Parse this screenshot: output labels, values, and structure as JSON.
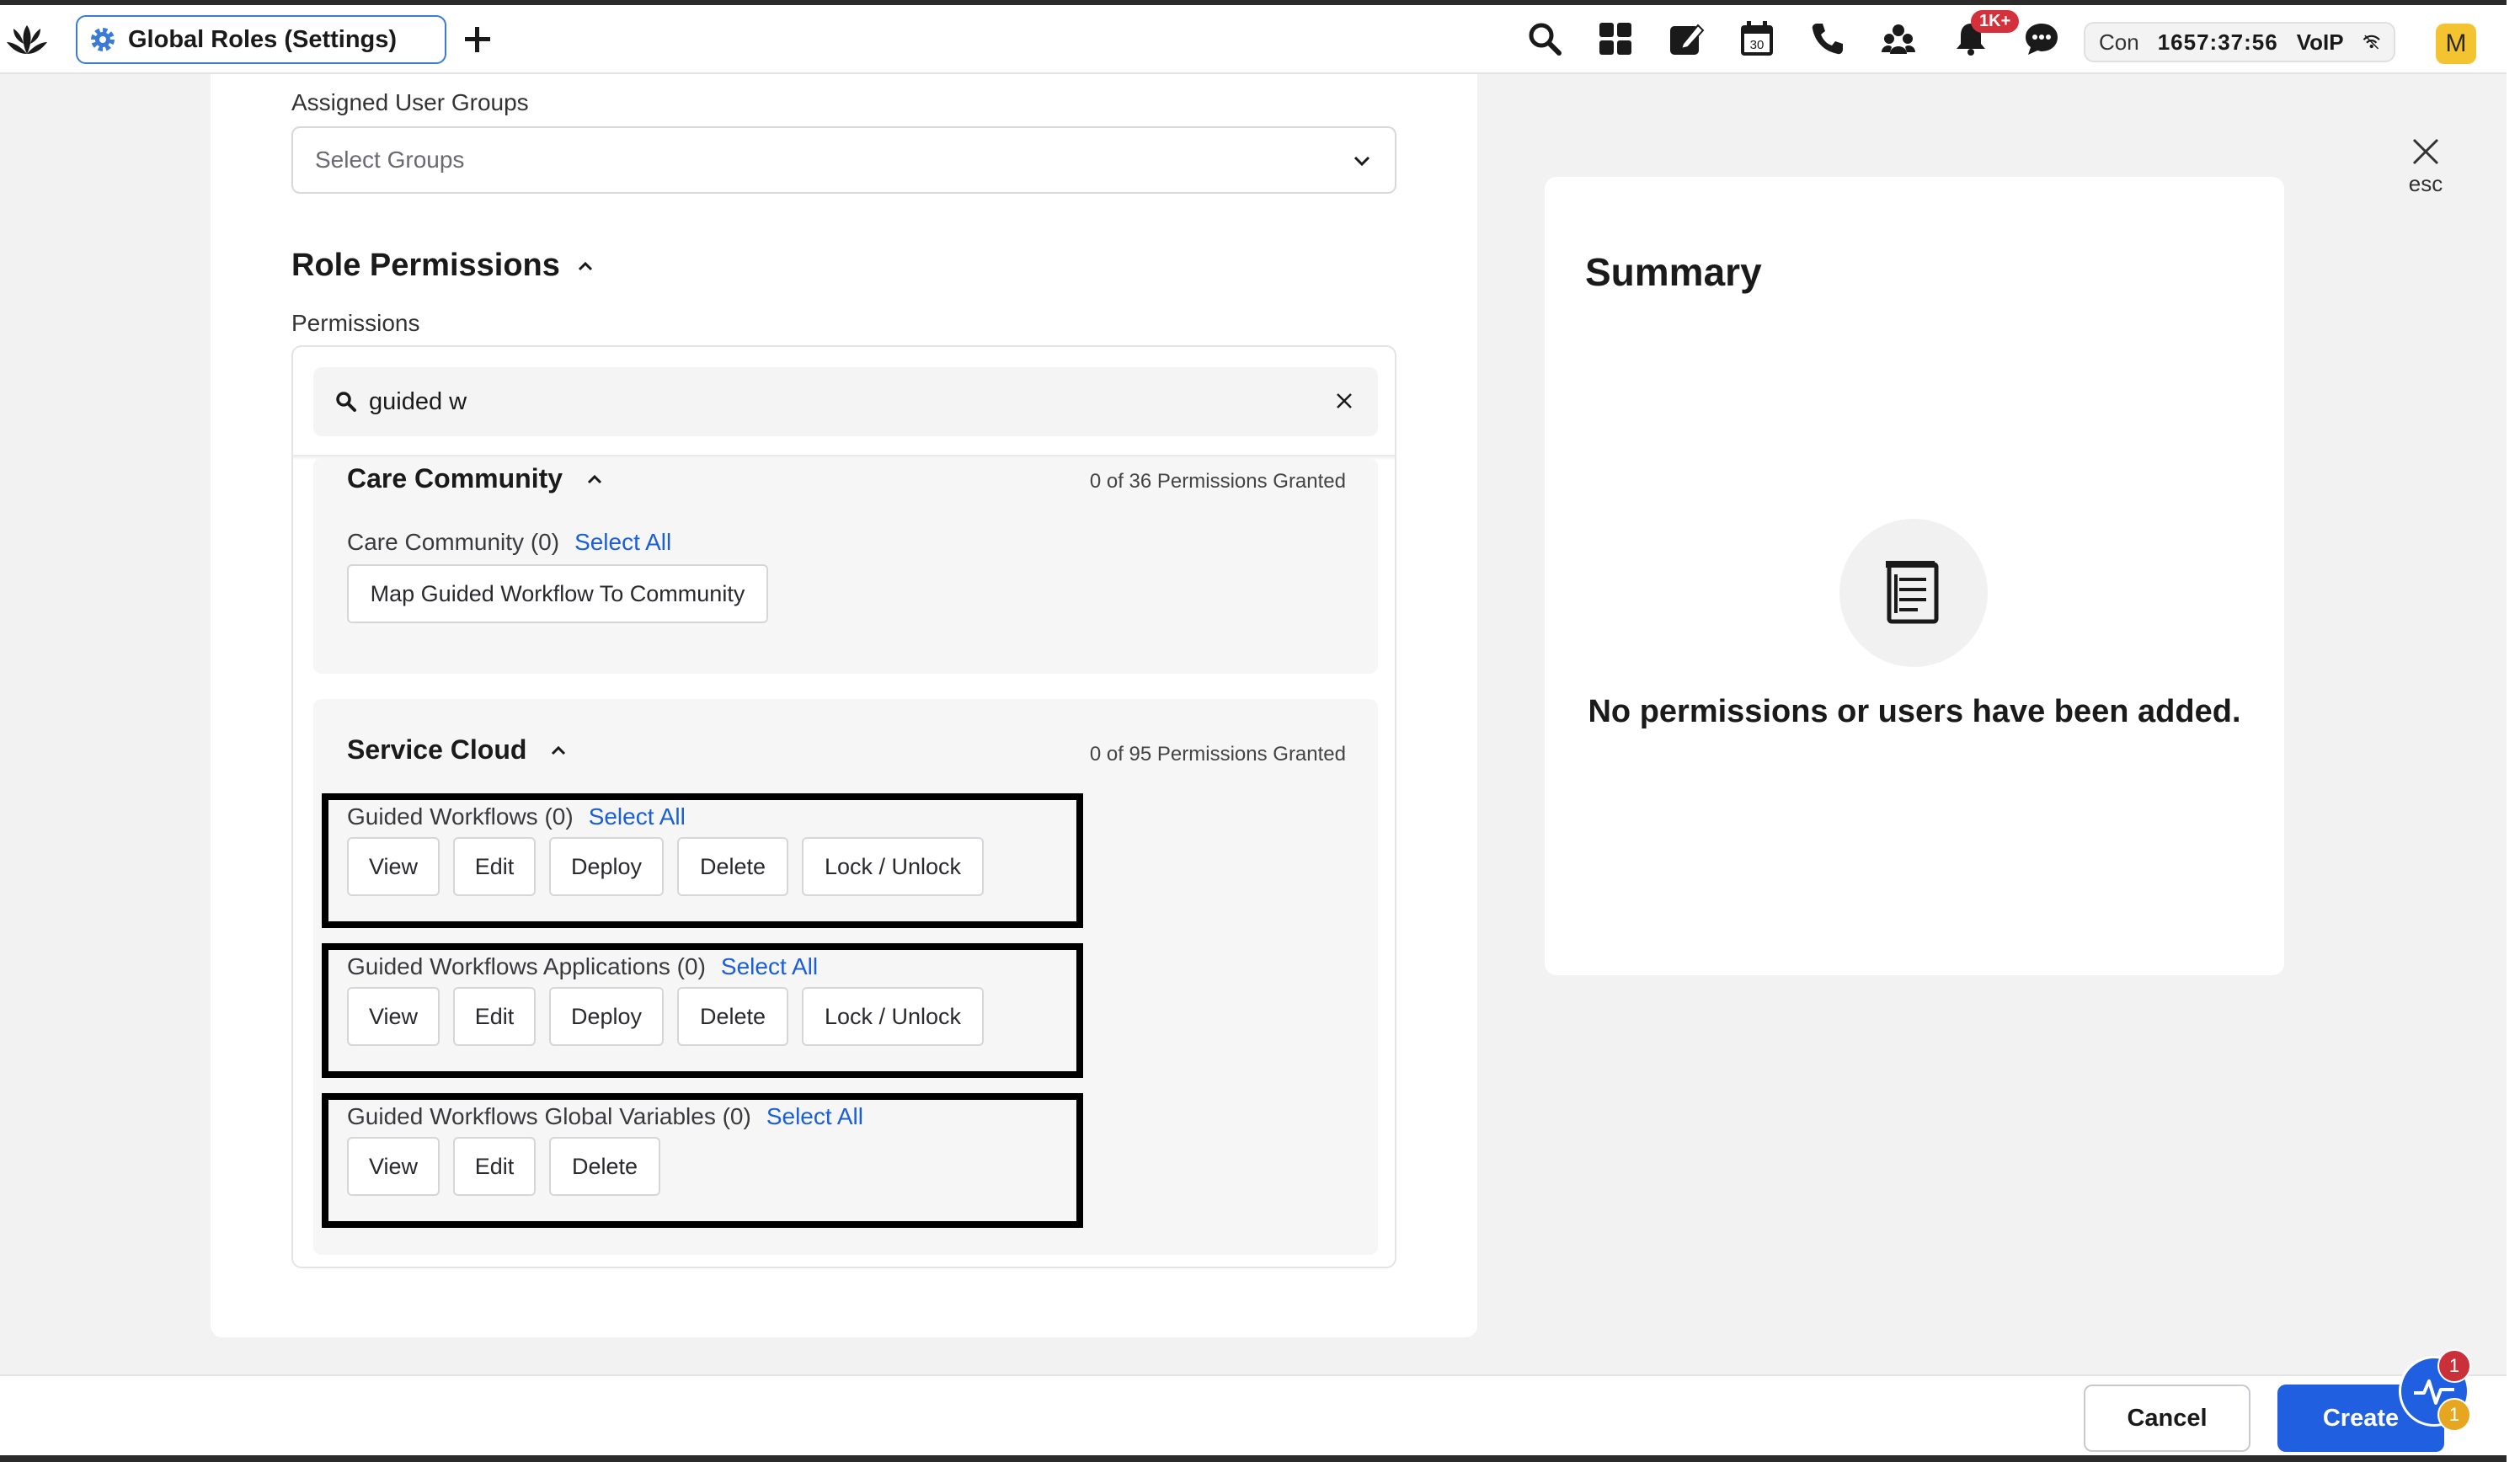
{
  "topbar": {
    "tab_title": "Global Roles (Settings)",
    "notification_badge": "1K+",
    "status": {
      "con_label": "Con",
      "timer": "1657:37:56",
      "voip_label": "VoIP"
    },
    "avatar_initial": "M",
    "icons": [
      "logo-icon",
      "gear-icon",
      "plus-icon",
      "search-icon",
      "grid-icon",
      "compose-icon",
      "calendar-icon",
      "phone-icon",
      "users-icon",
      "bell-icon",
      "chat-icon",
      "wifi-icon"
    ],
    "calendar_day": "30"
  },
  "form": {
    "assigned_groups_label": "Assigned User Groups",
    "assigned_groups_placeholder": "Select Groups",
    "role_permissions_title": "Role Permissions",
    "permissions_label": "Permissions",
    "search_value": "guided w"
  },
  "groups": [
    {
      "name": "Care Community",
      "granted": "0 of 36 Permissions Granted",
      "items": [
        {
          "label": "Care Community (0)",
          "select_all": "Select All",
          "actions": [
            "Map Guided Workflow To Community"
          ]
        }
      ]
    },
    {
      "name": "Service Cloud",
      "granted": "0 of 95 Permissions Granted",
      "items": [
        {
          "label": "Guided Workflows (0)",
          "select_all": "Select All",
          "actions": [
            "View",
            "Edit",
            "Deploy",
            "Delete",
            "Lock / Unlock"
          ]
        },
        {
          "label": "Guided Workflows Applications (0)",
          "select_all": "Select All",
          "actions": [
            "View",
            "Edit",
            "Deploy",
            "Delete",
            "Lock / Unlock"
          ]
        },
        {
          "label": "Guided Workflows Global Variables (0)",
          "select_all": "Select All",
          "actions": [
            "View",
            "Edit",
            "Delete"
          ]
        }
      ]
    }
  ],
  "summary": {
    "title": "Summary",
    "empty_message": "No permissions or users have been added.",
    "close_label": "esc"
  },
  "footer": {
    "cancel_label": "Cancel",
    "create_label": "Create",
    "fab_badge_top": "1",
    "fab_badge_bottom": "1"
  },
  "colors": {
    "accent": "#1f5fe0",
    "link": "#1a5fd6",
    "badge": "#d4313c",
    "highlight_border": "#000000"
  }
}
